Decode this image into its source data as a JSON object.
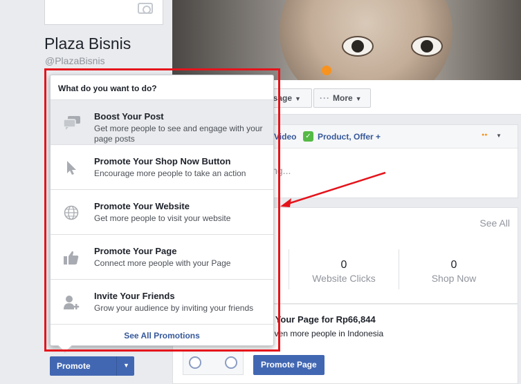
{
  "page": {
    "name": "Plaza Bisnis",
    "handle": "@PlazaBisnis"
  },
  "actions": {
    "message_label": "ssage",
    "more_label": "More"
  },
  "composer": {
    "video_label": "Video",
    "product_label": "Product, Offer +",
    "placeholder": "ing..."
  },
  "stats": {
    "see_all": "See All",
    "items": [
      {
        "value": "0",
        "label": "Website Clicks"
      },
      {
        "value": "0",
        "label": "Shop Now"
      }
    ]
  },
  "promo": {
    "title": "t Your Page for Rp66,844",
    "subtitle": "even more people in Indonesia",
    "button_label": "Promote Page"
  },
  "promote_button": {
    "label": "Promote"
  },
  "dropdown": {
    "header": "What do you want to do?",
    "items": [
      {
        "title": "Boost Your Post",
        "description": "Get more people to see and engage with your page posts",
        "icon": "speech-bubbles-icon"
      },
      {
        "title": "Promote Your Shop Now Button",
        "description": "Encourage more people to take an action",
        "icon": "cursor-icon"
      },
      {
        "title": "Promote Your Website",
        "description": "Get more people to visit your website",
        "icon": "globe-icon"
      },
      {
        "title": "Promote Your Page",
        "description": "Connect more people with your Page",
        "icon": "thumbs-up-icon"
      },
      {
        "title": "Invite Your Friends",
        "description": "Grow your audience by inviting your friends",
        "icon": "add-person-icon"
      }
    ],
    "footer": "See All Promotions"
  },
  "colors": {
    "accent": "#4267b2",
    "link": "#365899",
    "annotation": "#e5131b",
    "highlight": "#f7931e"
  }
}
